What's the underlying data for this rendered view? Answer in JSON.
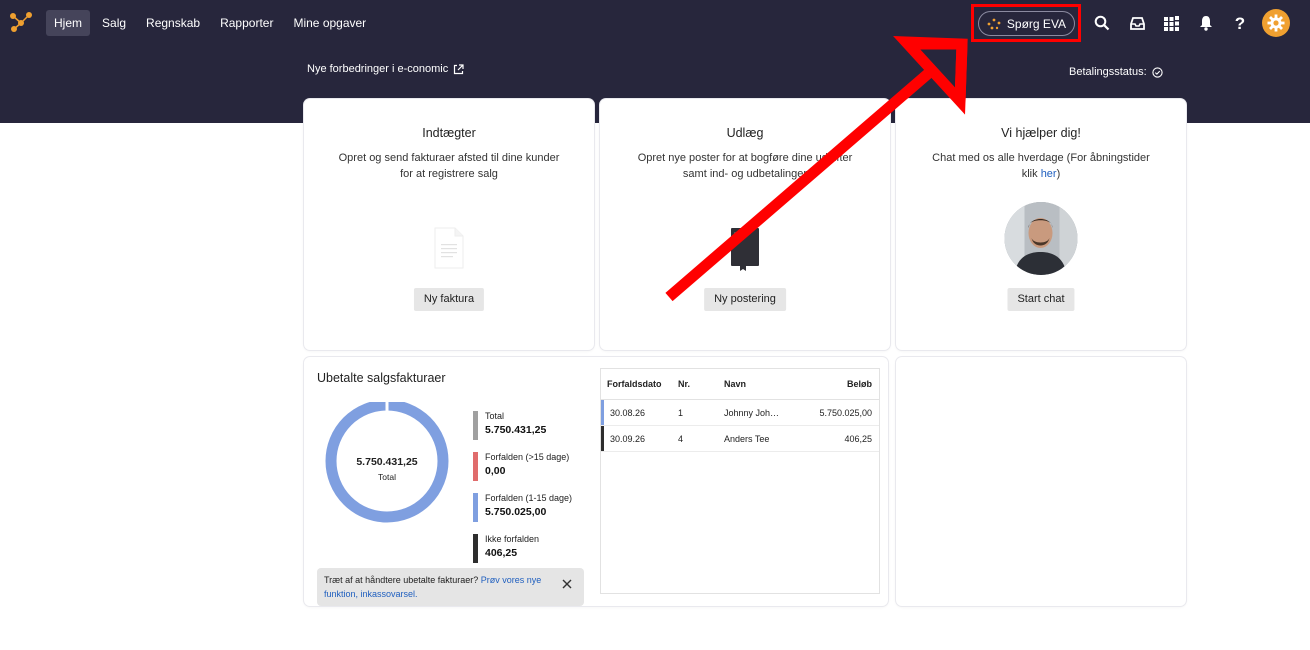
{
  "nav": {
    "items": [
      {
        "label": "Hjem",
        "active": true
      },
      {
        "label": "Salg",
        "active": false
      },
      {
        "label": "Regnskab",
        "active": false
      },
      {
        "label": "Rapporter",
        "active": false
      },
      {
        "label": "Mine opgaver",
        "active": false
      }
    ],
    "eva_label": "Spørg EVA",
    "icons": [
      "search-icon",
      "inbox-icon",
      "apps-grid-icon",
      "bell-icon",
      "help-icon",
      "settings-gear-icon"
    ]
  },
  "banner": {
    "news_link": "Nye forbedringer i e-conomic",
    "payment_status": "Betalingsstatus:"
  },
  "cards": {
    "income": {
      "title": "Indtægter",
      "desc": "Opret og send fakturaer afsted til dine kunder for at registrere salg",
      "button": "Ny faktura"
    },
    "expenses": {
      "title": "Udlæg",
      "desc": "Opret nye poster for at bogføre dine udgifter samt ind- og udbetalinger",
      "button": "Ny postering"
    },
    "help": {
      "title": "Vi hjælper dig!",
      "desc_before": "Chat med os alle hverdage (For åbningstider klik ",
      "desc_link": "her",
      "desc_after": ")",
      "button": "Start chat"
    }
  },
  "unpaid": {
    "title": "Ubetalte salgsfakturaer",
    "donut_value": "5.750.431,25",
    "donut_label": "Total",
    "legend": [
      {
        "label": "Total",
        "value": "5.750.431,25",
        "color": "#a0a0a0"
      },
      {
        "label": "Forfalden (>15 dage)",
        "value": "0,00",
        "color": "#e06c6c"
      },
      {
        "label": "Forfalden (1-15 dage)",
        "value": "5.750.025,00",
        "color": "#7f9fe0"
      },
      {
        "label": "Ikke forfalden",
        "value": "406,25",
        "color": "#2e2e2e"
      }
    ],
    "tip_text": "Træt af at håndtere ubetalte fakturaer? ",
    "tip_link": "Prøv vores nye funktion, inkassovarsel."
  },
  "table": {
    "headers": [
      "Forfaldsdato",
      "Nr.",
      "Navn",
      "Beløb"
    ],
    "rows": [
      {
        "date": "30.08.26",
        "nr": "1",
        "name": "Johnny Joh…",
        "amount": "5.750.025,00",
        "marker": "#7f9fe0"
      },
      {
        "date": "30.09.26",
        "nr": "4",
        "name": "Anders Tee",
        "amount": "406,25",
        "marker": "#2e2e2e"
      }
    ]
  },
  "colors": {
    "topbar": "#27263c",
    "accent_orange": "#f0a030",
    "highlight_red": "#ff0000",
    "donut_blue": "#7f9fe0"
  }
}
